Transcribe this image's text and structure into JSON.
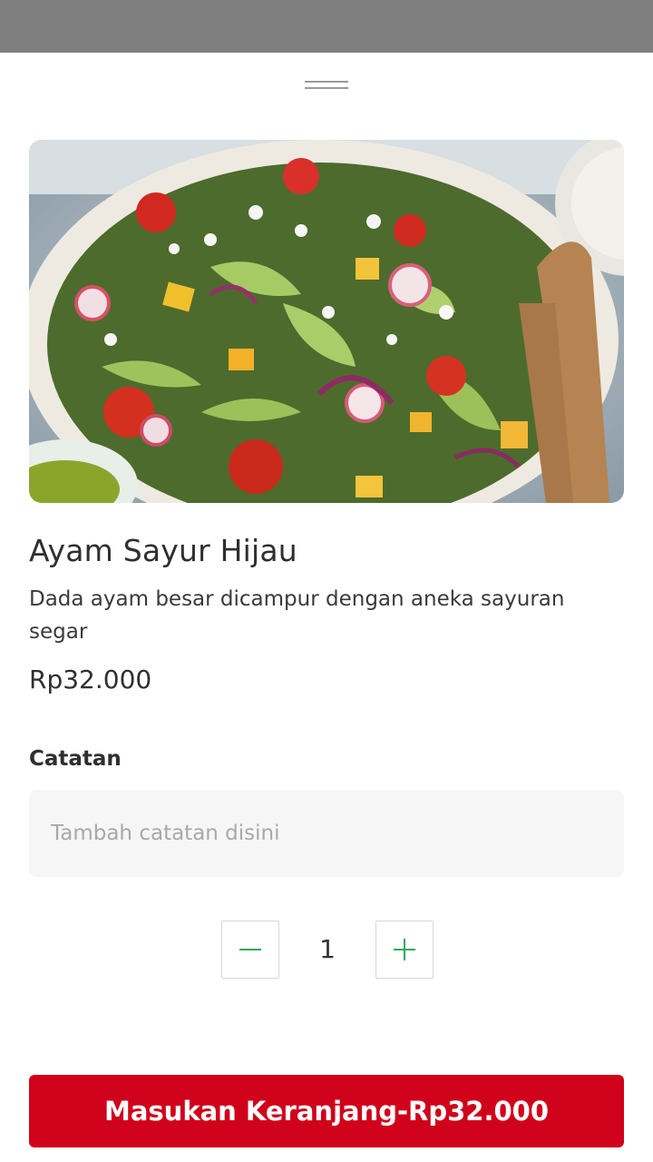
{
  "product": {
    "name": "Ayam Sayur Hijau",
    "description": "Dada ayam besar dicampur dengan aneka sayuran segar",
    "price": "Rp32.000",
    "image_icon": "salad-photo"
  },
  "notes": {
    "label": "Catatan",
    "placeholder": "Tambah catatan disini",
    "value": ""
  },
  "quantity": {
    "value": "1",
    "minus_icon": "minus-icon",
    "plus_icon": "plus-icon"
  },
  "cart_button": {
    "label": "Masukan Keranjang-Rp32.000"
  },
  "colors": {
    "accent": "#d0021b",
    "stepper_icon": "#2eaa5c",
    "overlay": "#7f7f7f"
  }
}
